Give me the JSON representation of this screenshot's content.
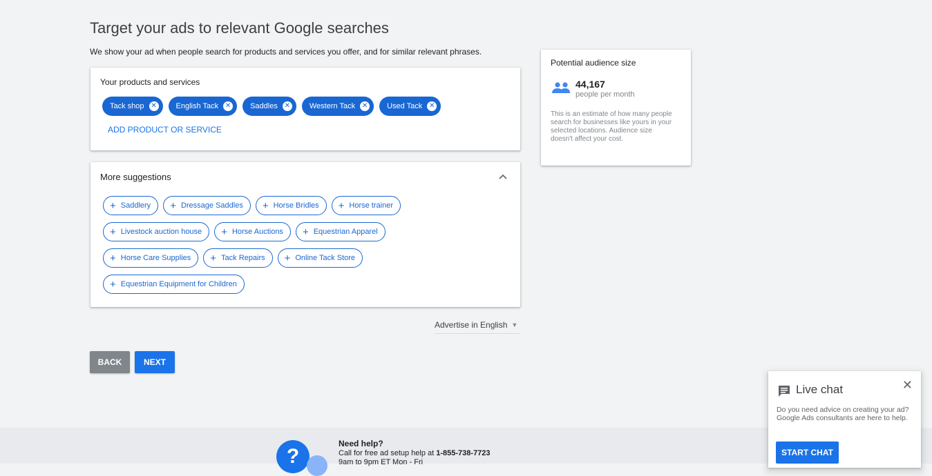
{
  "header": {
    "title": "Target your ads to relevant Google searches",
    "subtitle": "We show your ad when people search for products and services you offer, and for similar relevant phrases."
  },
  "products": {
    "heading": "Your products and services",
    "chips": [
      "Tack shop",
      "English Tack",
      "Saddles",
      "Western Tack",
      "Used Tack"
    ],
    "add_label": "ADD PRODUCT OR SERVICE"
  },
  "suggestions": {
    "heading": "More suggestions",
    "rows": [
      [
        "Saddlery",
        "Dressage Saddles",
        "Horse Bridles",
        "Horse trainer"
      ],
      [
        "Livestock auction house",
        "Horse Auctions",
        "Equestrian Apparel"
      ],
      [
        "Horse Care Supplies",
        "Tack Repairs",
        "Online Tack Store"
      ],
      [
        "Equestrian Equipment for Children"
      ]
    ]
  },
  "language": {
    "label": "Advertise in English"
  },
  "actions": {
    "back_label": "BACK",
    "next_label": "NEXT"
  },
  "audience": {
    "heading": "Potential audience size",
    "count": "44,167",
    "unit": "people per month",
    "description": "This is an estimate of how many people search for businesses like yours in your selected locations. Audience size doesn't affect your cost."
  },
  "footer": {
    "title": "Need help?",
    "call_text": "Call for free ad setup help at ",
    "phone": "1-855-738-7723",
    "hours": "9am to 9pm ET Mon - Fri"
  },
  "chat": {
    "title": "Live chat",
    "description": "Do you need advice on creating your ad? Google Ads consultants are here to help.",
    "button_label": "START CHAT"
  },
  "colors": {
    "primary": "#1a73e8",
    "chip": "#1967d2",
    "back": "#80868b",
    "background": "#f1f3f4"
  }
}
